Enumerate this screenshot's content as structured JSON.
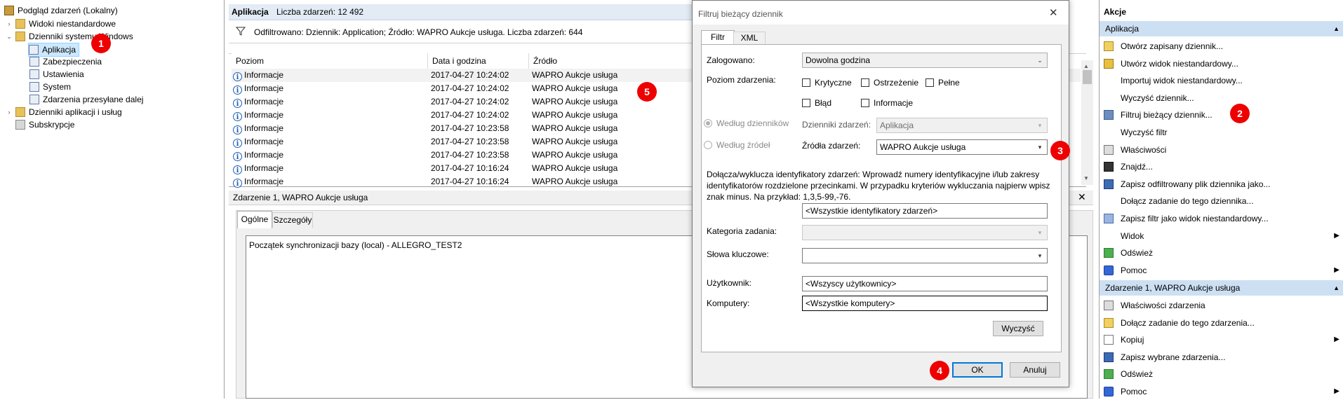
{
  "tree": {
    "root": "Podgląd zdarzeń (Lokalny)",
    "items": [
      {
        "label": "Widoki niestandardowe",
        "toggle": "›"
      },
      {
        "label": "Dzienniki systemu Windows",
        "toggle": "⌄"
      },
      {
        "label": "Aplikacja"
      },
      {
        "label": "Zabezpieczenia"
      },
      {
        "label": "Ustawienia"
      },
      {
        "label": "System"
      },
      {
        "label": "Zdarzenia przesyłane dalej"
      },
      {
        "label": "Dzienniki aplikacji i usług",
        "toggle": "›"
      },
      {
        "label": "Subskrypcje"
      }
    ]
  },
  "badges": [
    "1",
    "2",
    "3",
    "4",
    "5"
  ],
  "center": {
    "title": "Aplikacja",
    "count_label": "Liczba zdarzeń: 12 492",
    "filter_text": "Odfiltrowano: Dziennik: Application; Źródło: WAPRO Aukcje usługa. Liczba zdarzeń: 644",
    "columns": [
      "Poziom",
      "Data i godzina",
      "Źródło"
    ],
    "rows": [
      {
        "level": "Informacje",
        "date": "2017-04-27 10:24:02",
        "source": "WAPRO Aukcje usługa"
      },
      {
        "level": "Informacje",
        "date": "2017-04-27 10:24:02",
        "source": "WAPRO Aukcje usługa"
      },
      {
        "level": "Informacje",
        "date": "2017-04-27 10:24:02",
        "source": "WAPRO Aukcje usługa"
      },
      {
        "level": "Informacje",
        "date": "2017-04-27 10:24:02",
        "source": "WAPRO Aukcje usługa"
      },
      {
        "level": "Informacje",
        "date": "2017-04-27 10:23:58",
        "source": "WAPRO Aukcje usługa"
      },
      {
        "level": "Informacje",
        "date": "2017-04-27 10:23:58",
        "source": "WAPRO Aukcje usługa"
      },
      {
        "level": "Informacje",
        "date": "2017-04-27 10:23:58",
        "source": "WAPRO Aukcje usługa"
      },
      {
        "level": "Informacje",
        "date": "2017-04-27 10:16:24",
        "source": "WAPRO Aukcje usługa"
      },
      {
        "level": "Informacje",
        "date": "2017-04-27 10:16:24",
        "source": "WAPRO Aukcje usługa"
      }
    ],
    "event_title": "Zdarzenie 1, WAPRO Aukcje usługa",
    "tabs": [
      "Ogólne",
      "Szczegóły"
    ],
    "event_text": "Początek synchronizacji bazy (local) - ALLEGRO_TEST2",
    "close_glyph": "✕"
  },
  "dialog": {
    "title": "Filtruj bieżący dziennik",
    "close_glyph": "✕",
    "tabs": [
      "Filtr",
      "XML"
    ],
    "logged_label": "Zalogowano:",
    "logged_value": "Dowolna godzina",
    "level_label": "Poziom zdarzenia:",
    "levels": [
      "Krytyczne",
      "Ostrzeżenie",
      "Pełne",
      "Błąd",
      "Informacje"
    ],
    "by_logs": "Według dzienników",
    "by_sources": "Według źródeł",
    "logs_label": "Dzienniki zdarzeń:",
    "logs_value": "Aplikacja",
    "sources_label": "Źródła zdarzeń:",
    "sources_value": "WAPRO Aukcje usługa",
    "ids_help": "Dołącza/wyklucza identyfikatory zdarzeń: Wprowadź numery identyfikacyjne i/lub zakresy identyfikatorów rozdzielone przecinkami. W przypadku kryteriów wykluczania najpierw wpisz znak minus. Na przykład: 1,3,5-99,-76.",
    "ids_value": "<Wszystkie identyfikatory zdarzeń>",
    "category_label": "Kategoria zadania:",
    "keywords_label": "Słowa kluczowe:",
    "user_label": "Użytkownik:",
    "user_value": "<Wszyscy użytkownicy>",
    "computers_label": "Komputery:",
    "computers_value": "<Wszystkie komputery>",
    "clear_button": "Wyczyść",
    "ok_button": "OK",
    "cancel_button": "Anuluj"
  },
  "actions": {
    "header": "Akcje",
    "section1": "Aplikacja",
    "items1": [
      "Otwórz zapisany dziennik...",
      "Utwórz widok niestandardowy...",
      "Importuj widok niestandardowy...",
      "Wyczyść dziennik...",
      "Filtruj bieżący dziennik...",
      "Wyczyść filtr",
      "Właściwości",
      "Znajdź...",
      "Zapisz odfiltrowany plik dziennika jako...",
      "Dołącz zadanie do tego dziennika...",
      "Zapisz filtr jako widok niestandardowy...",
      "Widok",
      "Odśwież",
      "Pomoc"
    ],
    "section2": "Zdarzenie 1, WAPRO Aukcje usługa",
    "items2": [
      "Właściwości zdarzenia",
      "Dołącz zadanie do tego zdarzenia...",
      "Kopiuj",
      "Zapisz wybrane zdarzenia...",
      "Odśwież",
      "Pomoc"
    ]
  }
}
